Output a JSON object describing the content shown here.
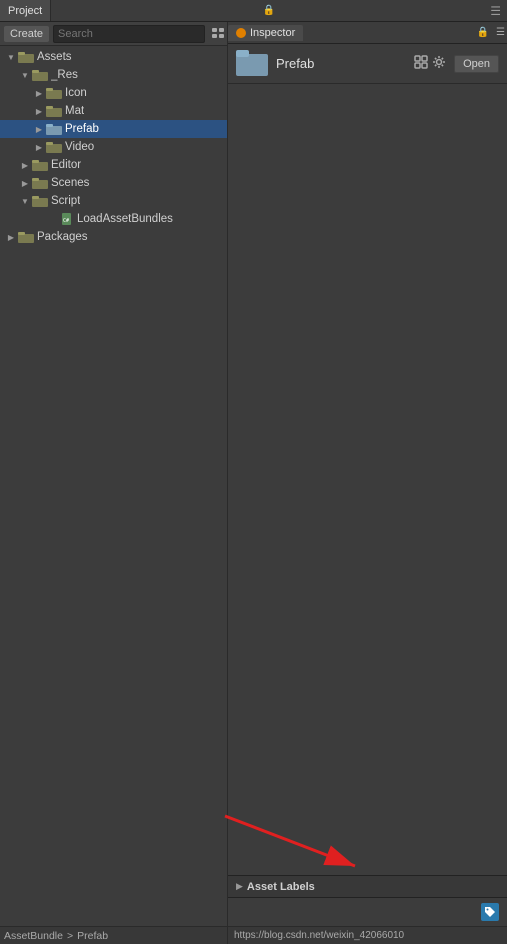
{
  "tabs": {
    "project": {
      "label": "Project",
      "active": true
    },
    "inspector": {
      "label": "Inspector",
      "active": true,
      "icon": "circle"
    }
  },
  "project_toolbar": {
    "create_label": "Create",
    "search_placeholder": "Search"
  },
  "tree": {
    "items": [
      {
        "id": "assets",
        "label": "Assets",
        "indent": "indent-1",
        "arrow": "expanded",
        "type": "folder",
        "selected": false
      },
      {
        "id": "_res",
        "label": "_Res",
        "indent": "indent-2",
        "arrow": "expanded",
        "type": "folder",
        "selected": false
      },
      {
        "id": "icon",
        "label": "Icon",
        "indent": "indent-3",
        "arrow": "collapsed",
        "type": "folder",
        "selected": false
      },
      {
        "id": "mat",
        "label": "Mat",
        "indent": "indent-3",
        "arrow": "collapsed",
        "type": "folder",
        "selected": false
      },
      {
        "id": "prefab",
        "label": "Prefab",
        "indent": "indent-3",
        "arrow": "collapsed",
        "type": "folder",
        "selected": true
      },
      {
        "id": "video",
        "label": "Video",
        "indent": "indent-3",
        "arrow": "collapsed",
        "type": "folder",
        "selected": false
      },
      {
        "id": "editor",
        "label": "Editor",
        "indent": "indent-2",
        "arrow": "collapsed",
        "type": "folder",
        "selected": false
      },
      {
        "id": "scenes",
        "label": "Scenes",
        "indent": "indent-2",
        "arrow": "collapsed",
        "type": "folder",
        "selected": false
      },
      {
        "id": "script",
        "label": "Script",
        "indent": "indent-2",
        "arrow": "expanded",
        "type": "folder",
        "selected": false
      },
      {
        "id": "loadassetbundles",
        "label": "LoadAssetBundles",
        "indent": "indent-3",
        "arrow": "empty",
        "type": "file",
        "selected": false
      },
      {
        "id": "packages",
        "label": "Packages",
        "indent": "indent-1",
        "arrow": "collapsed",
        "type": "folder",
        "selected": false
      }
    ]
  },
  "inspector": {
    "prefab_title": "Prefab",
    "open_btn": "Open",
    "asset_labels_title": "Asset Labels"
  },
  "bottom_bar": {
    "left_label": "AssetBundle",
    "center_label": "Prefab"
  },
  "url_bar": {
    "url": "https://blog.csdn.net/weixin_42066010"
  }
}
